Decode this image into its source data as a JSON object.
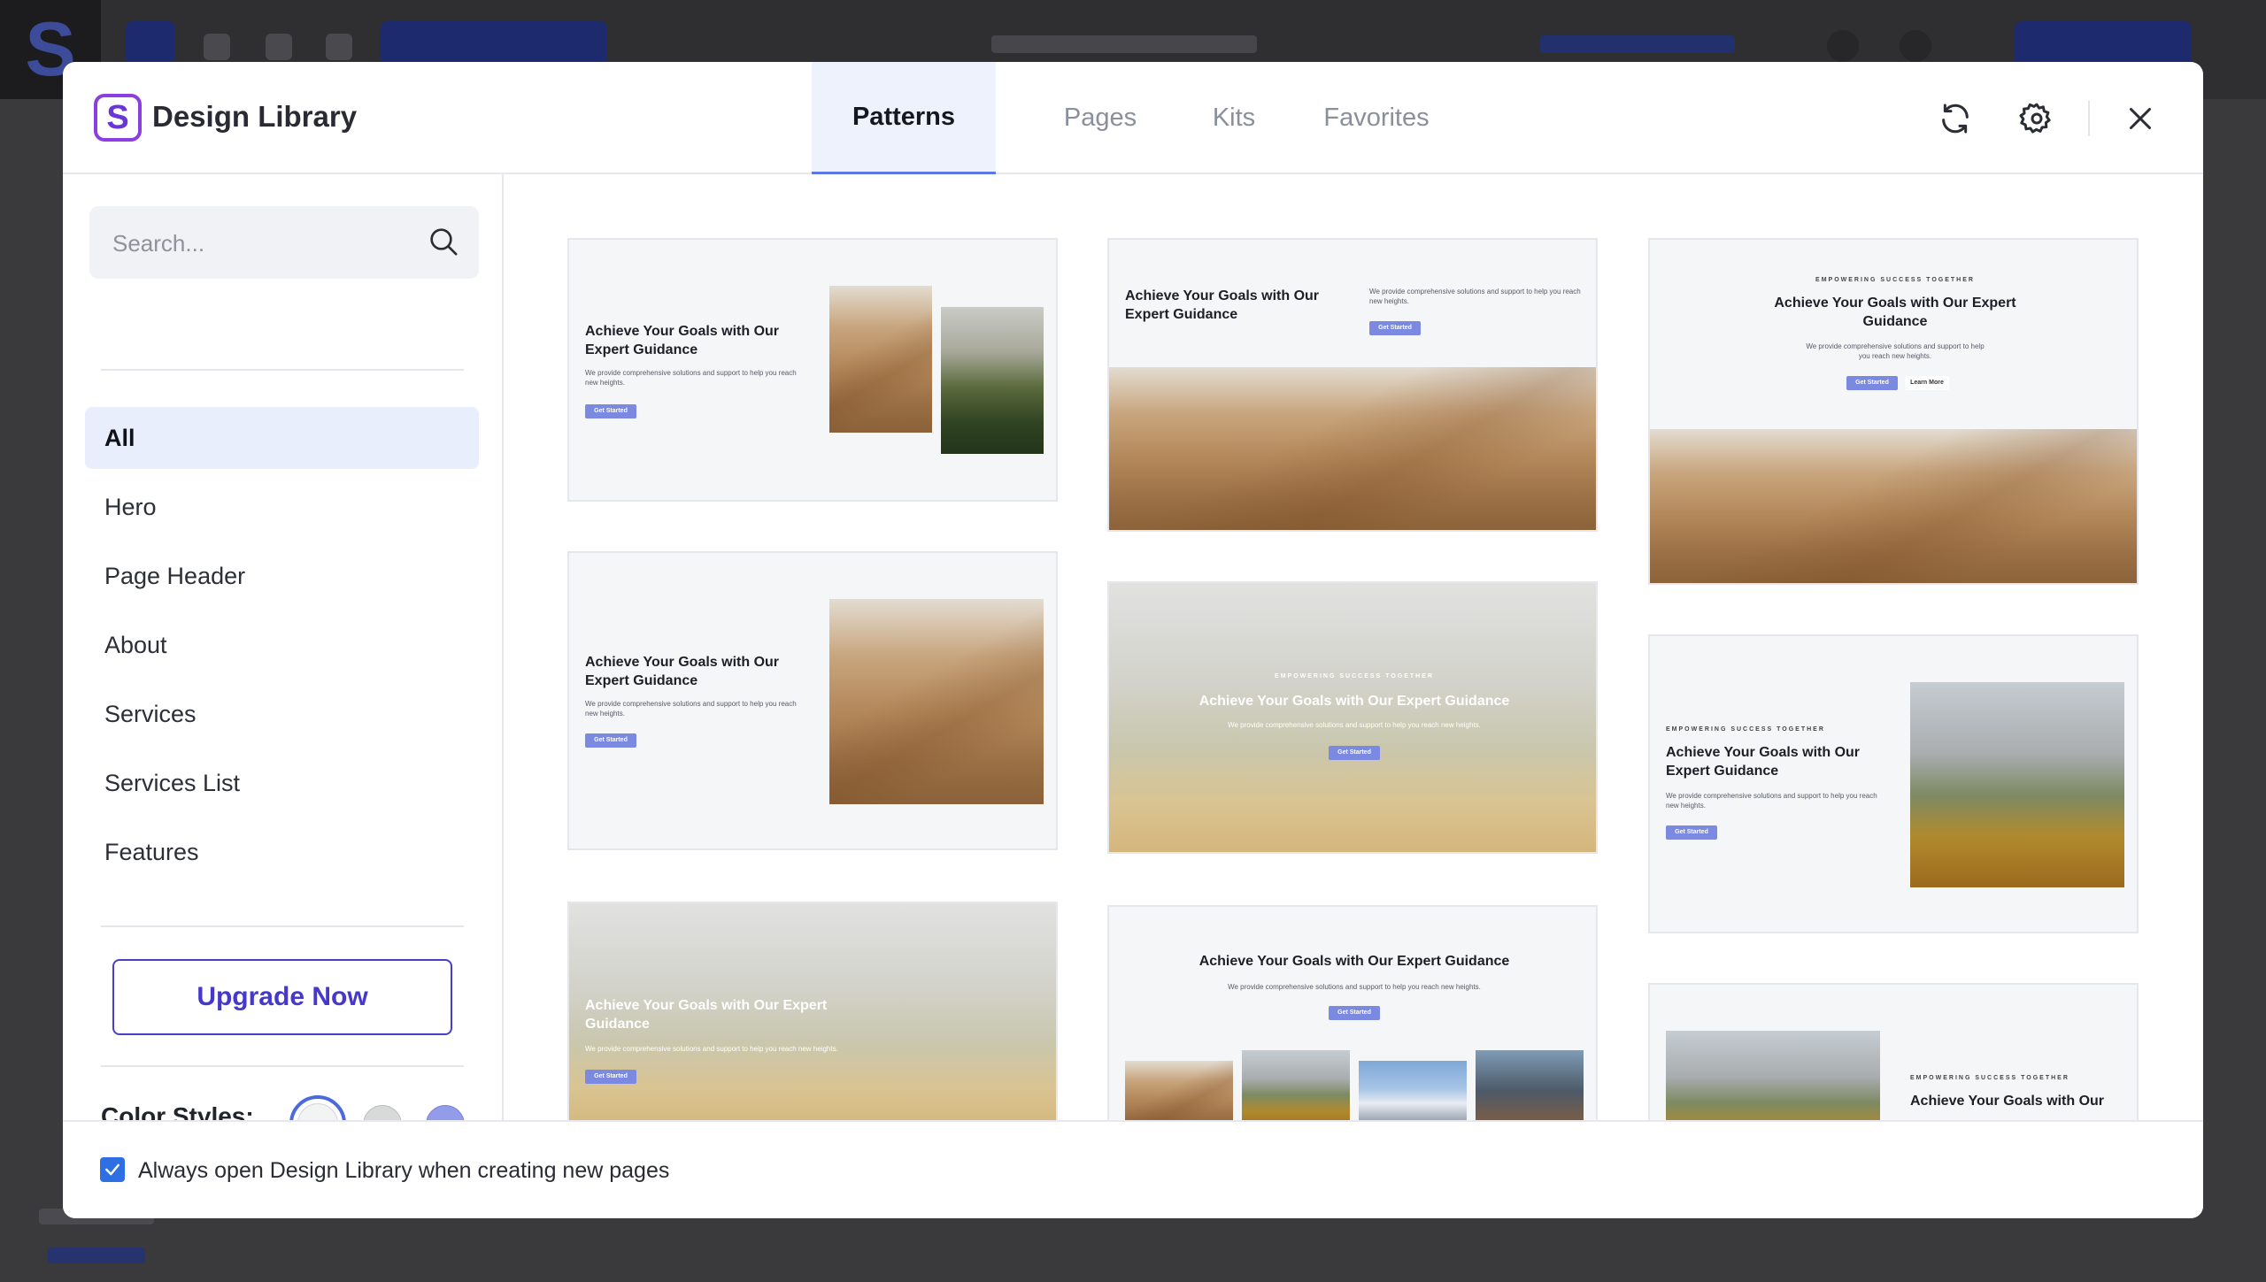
{
  "modal": {
    "title": "Design Library",
    "tabs": [
      {
        "label": "Patterns",
        "active": true
      },
      {
        "label": "Pages",
        "active": false
      },
      {
        "label": "Kits",
        "active": false
      },
      {
        "label": "Favorites",
        "active": false
      }
    ],
    "header_icons": [
      "refresh-icon",
      "gear-icon",
      "close-icon"
    ]
  },
  "sidebar": {
    "search": {
      "placeholder": "Search..."
    },
    "categories": [
      {
        "label": "All",
        "active": true
      },
      {
        "label": "Hero"
      },
      {
        "label": "Page Header"
      },
      {
        "label": "About"
      },
      {
        "label": "Services"
      },
      {
        "label": "Services List"
      },
      {
        "label": "Features"
      }
    ],
    "upgrade_label": "Upgrade Now",
    "color_styles_label": "Color Styles:",
    "color_styles": [
      {
        "color": "#f2f3f3",
        "selected": true
      },
      {
        "color": "#d7dad9",
        "selected": false
      },
      {
        "color": "#929ce8",
        "selected": false
      }
    ]
  },
  "patterns": {
    "title": "Achieve Your Goals with Our Expert Guidance",
    "title_split_a": "Achieve Your Goals with Our",
    "title_split_b": "Expert Guidance",
    "title_split_c": "Achieve Your Goals with Our Expert",
    "title_split_d": "Guidance",
    "description": "We provide comprehensive solutions and support to help you reach new heights.",
    "eyebrow": "EMPOWERING SUCCESS TOGETHER",
    "button_primary": "Get Started",
    "button_secondary": "Learn More"
  },
  "footer": {
    "checkbox_checked": true,
    "checkbox_label": "Always open Design Library when creating new pages"
  },
  "accent_color": "#5b78e6"
}
